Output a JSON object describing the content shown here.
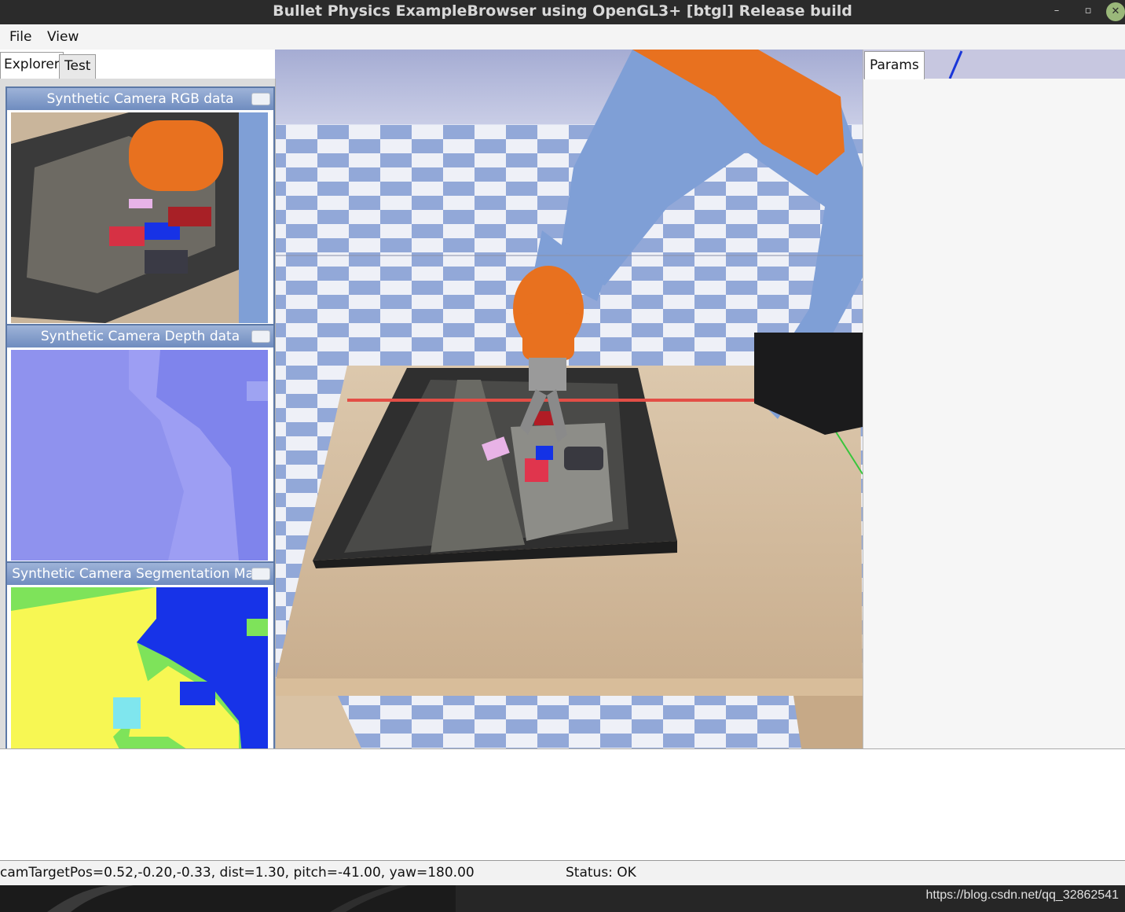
{
  "window": {
    "title": "Bullet Physics ExampleBrowser using OpenGL3+ [btgl] Release build",
    "minimize_symbol": "–",
    "restore_symbol": "▫"
  },
  "menu": {
    "file": "File",
    "view": "View"
  },
  "left_tabs": {
    "explorer": "Explorer",
    "test": "Test"
  },
  "cameras": {
    "rgb": {
      "title": "Synthetic Camera RGB data"
    },
    "depth": {
      "title": "Synthetic Camera Depth data"
    },
    "segmentation": {
      "title": "Synthetic Camera Segmentation Mask"
    }
  },
  "params": {
    "tab": "Params"
  },
  "status": {
    "camera": "camTargetPos=0.52,-0.20,-0.33, dist=1.30, pitch=-41.00, yaw=180.00",
    "state": "Status: OK"
  },
  "watermark": "https://blog.csdn.net/qq_32862541",
  "colors": {
    "title_bar": "#2b2b2b",
    "camera_header": "#6f8cbf",
    "robot_orange": "#e8711f",
    "robot_blue": "#7f9fd6",
    "checker_blue": "#92a8d8",
    "segmentation_yellow": "#f7f753",
    "segmentation_blue": "#1733e8",
    "segmentation_green": "#7ee35a",
    "depth_violet": "#8d8ef0"
  }
}
